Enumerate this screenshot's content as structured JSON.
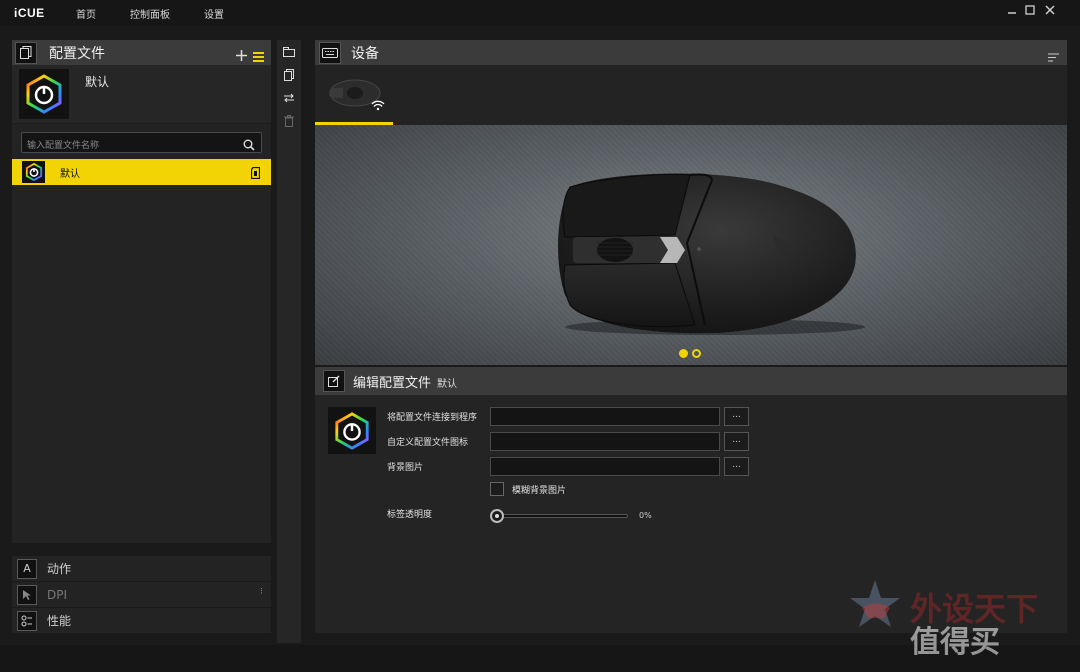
{
  "app": {
    "title": "iCUE"
  },
  "nav": {
    "home": "首页",
    "dashboard": "控制面板",
    "settings": "设置"
  },
  "profiles": {
    "header": "配置文件",
    "current_name": "默认",
    "search_placeholder": "输入配置文件名称",
    "list": [
      {
        "label": "默认"
      }
    ]
  },
  "sections": [
    {
      "icon": "actions-icon",
      "label": "动作"
    },
    {
      "icon": "dpi-icon",
      "label": "DPI"
    },
    {
      "icon": "performance-icon",
      "label": "性能"
    }
  ],
  "devices": {
    "header": "设备"
  },
  "edit": {
    "title": "编辑配置文件",
    "profile": "默认",
    "fields": [
      {
        "label": "将配置文件连接到程序",
        "value": "",
        "button": "..."
      },
      {
        "label": "自定义配置文件图标",
        "value": "",
        "button": "..."
      },
      {
        "label": "背景图片",
        "value": "",
        "button": "..."
      }
    ],
    "blur_label": "模糊背景图片",
    "opacity_label": "标签透明度",
    "opacity_value": "0%",
    "opacity_level": 0
  },
  "colors": {
    "accent": "#f2d404",
    "panel": "#232323",
    "header": "#3b3b3b"
  }
}
